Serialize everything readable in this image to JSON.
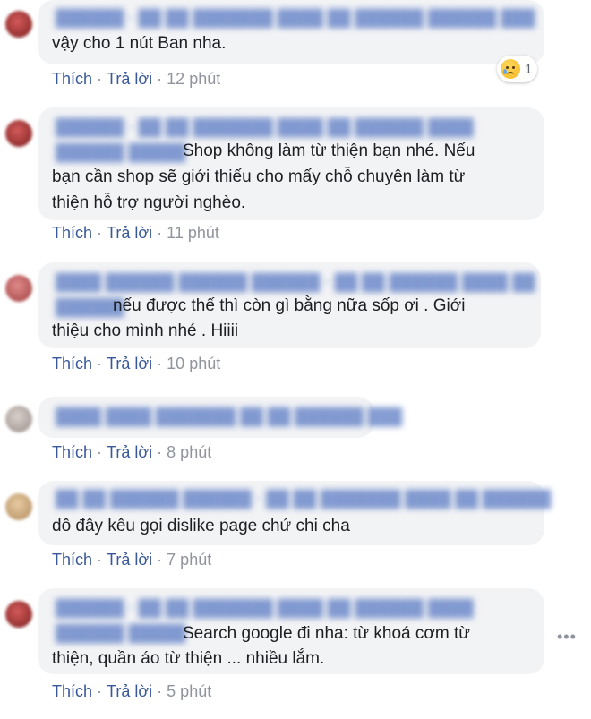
{
  "colors": {
    "bubble": "#f2f3f5",
    "link": "#385898",
    "meta": "#90949c",
    "text": "#1c1e21"
  },
  "actions": {
    "like": "Thích",
    "reply": "Trả lời",
    "separator": "·"
  },
  "comments": [
    {
      "line1": "vậy cho 1 nút Ban nha.",
      "time": "12 phút",
      "reaction": {
        "icon": "sad-cry-emoji-icon",
        "count": "1"
      }
    },
    {
      "line1": "Shop không làm từ thiện bạn nhé. Nếu",
      "line2": "bạn cần shop sẽ giới thiếu cho mấy chỗ chuyên làm từ",
      "line3": "thiện hỗ trợ người nghèo.",
      "time": "11 phút"
    },
    {
      "line1": "nếu được thế thì còn gì bằng nữa sốp ơi . Giới",
      "line2": "thiệu cho mình nhé . Hiiii",
      "time": "10 phút"
    },
    {
      "time": "8 phút"
    },
    {
      "line1": "dô đây kêu gọi dislike page chứ chi cha",
      "time": "7 phút"
    },
    {
      "line1": "Search google đi nha: từ khoá cơm từ",
      "line2": "thiện, quần áo từ thiện ... nhiều lắm.",
      "time": "5 phút",
      "more": "•••"
    }
  ]
}
